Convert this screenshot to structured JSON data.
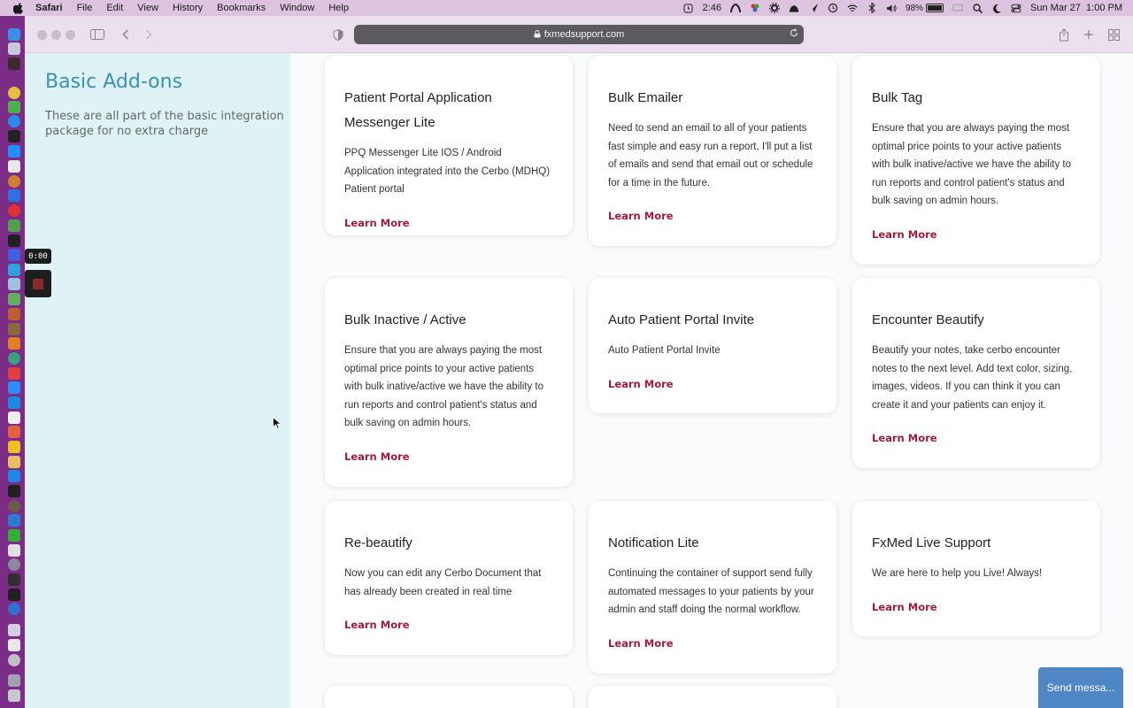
{
  "menubar": {
    "app": "Safari",
    "items": [
      "File",
      "Edit",
      "View",
      "History",
      "Bookmarks",
      "Window",
      "Help"
    ],
    "timer": "2:46",
    "battery": "98%",
    "battery_level": 0.98,
    "datetime": "Sun Mar 27  1:00 PM"
  },
  "recording": {
    "time": "0:00"
  },
  "browser": {
    "url": "fxmedsupport.com"
  },
  "sidebar": {
    "title": "Basic Add-ons",
    "description": "These are all part of the basic integration package for no extra charge"
  },
  "cards": [
    {
      "title": "Patient Portal Application Messenger Lite",
      "description": "PPQ Messenger Lite IOS / Android Application integrated into the Cerbo (MDHQ) Patient portal",
      "link": "Learn More"
    },
    {
      "title": "Bulk Emailer",
      "description": "Need to send an email to all of your patients fast simple and easy run a report, I'll put a list of emails and send that email out or schedule for a time in the future.",
      "link": "Learn More"
    },
    {
      "title": "Bulk Tag",
      "description": "Ensure that you are always paying the most optimal price points to your active patients with bulk inative/active we have the ability to run reports and control patient's status and bulk saving on admin hours.",
      "link": "Learn More"
    },
    {
      "title": "Bulk Inactive / Active",
      "description": "Ensure that you are always paying the most optimal price points to your active patients with bulk inative/active we have the ability to run reports and control patient's status and bulk saving on admin hours.",
      "link": "Learn More"
    },
    {
      "title": "Auto Patient Portal Invite",
      "description": "Auto Patient Portal Invite",
      "link": "Learn More"
    },
    {
      "title": "Encounter Beautify",
      "description": "Beautify your notes, take cerbo encounter notes to the next level. Add text color, sizing, images, videos. If you can think it you can create it and your patients can enjoy it.",
      "link": "Learn More"
    },
    {
      "title": "Re-beautify",
      "description": "Now you can edit any Cerbo Document that has already been created in real time",
      "link": "Learn More"
    },
    {
      "title": "Notification Lite",
      "description": "Continuing the container of support send fully automated messages to your patients by your admin and staff doing the normal workflow.",
      "link": "Learn More"
    },
    {
      "title": "FxMed Live Support",
      "description": "We are here to help you Live! Always!",
      "link": "Learn More"
    }
  ],
  "chat": {
    "label": "Send messa..."
  },
  "icons": {
    "apple": "apple-icon",
    "wifi": "wifi-icon",
    "bluetooth": "bluetooth-icon",
    "volume": "volume-icon",
    "search": "search-icon",
    "lock": "lock-icon",
    "reload": "reload-icon",
    "share": "share-icon",
    "new-tab": "plus-icon",
    "tab-overview": "tab-overview-icon"
  }
}
